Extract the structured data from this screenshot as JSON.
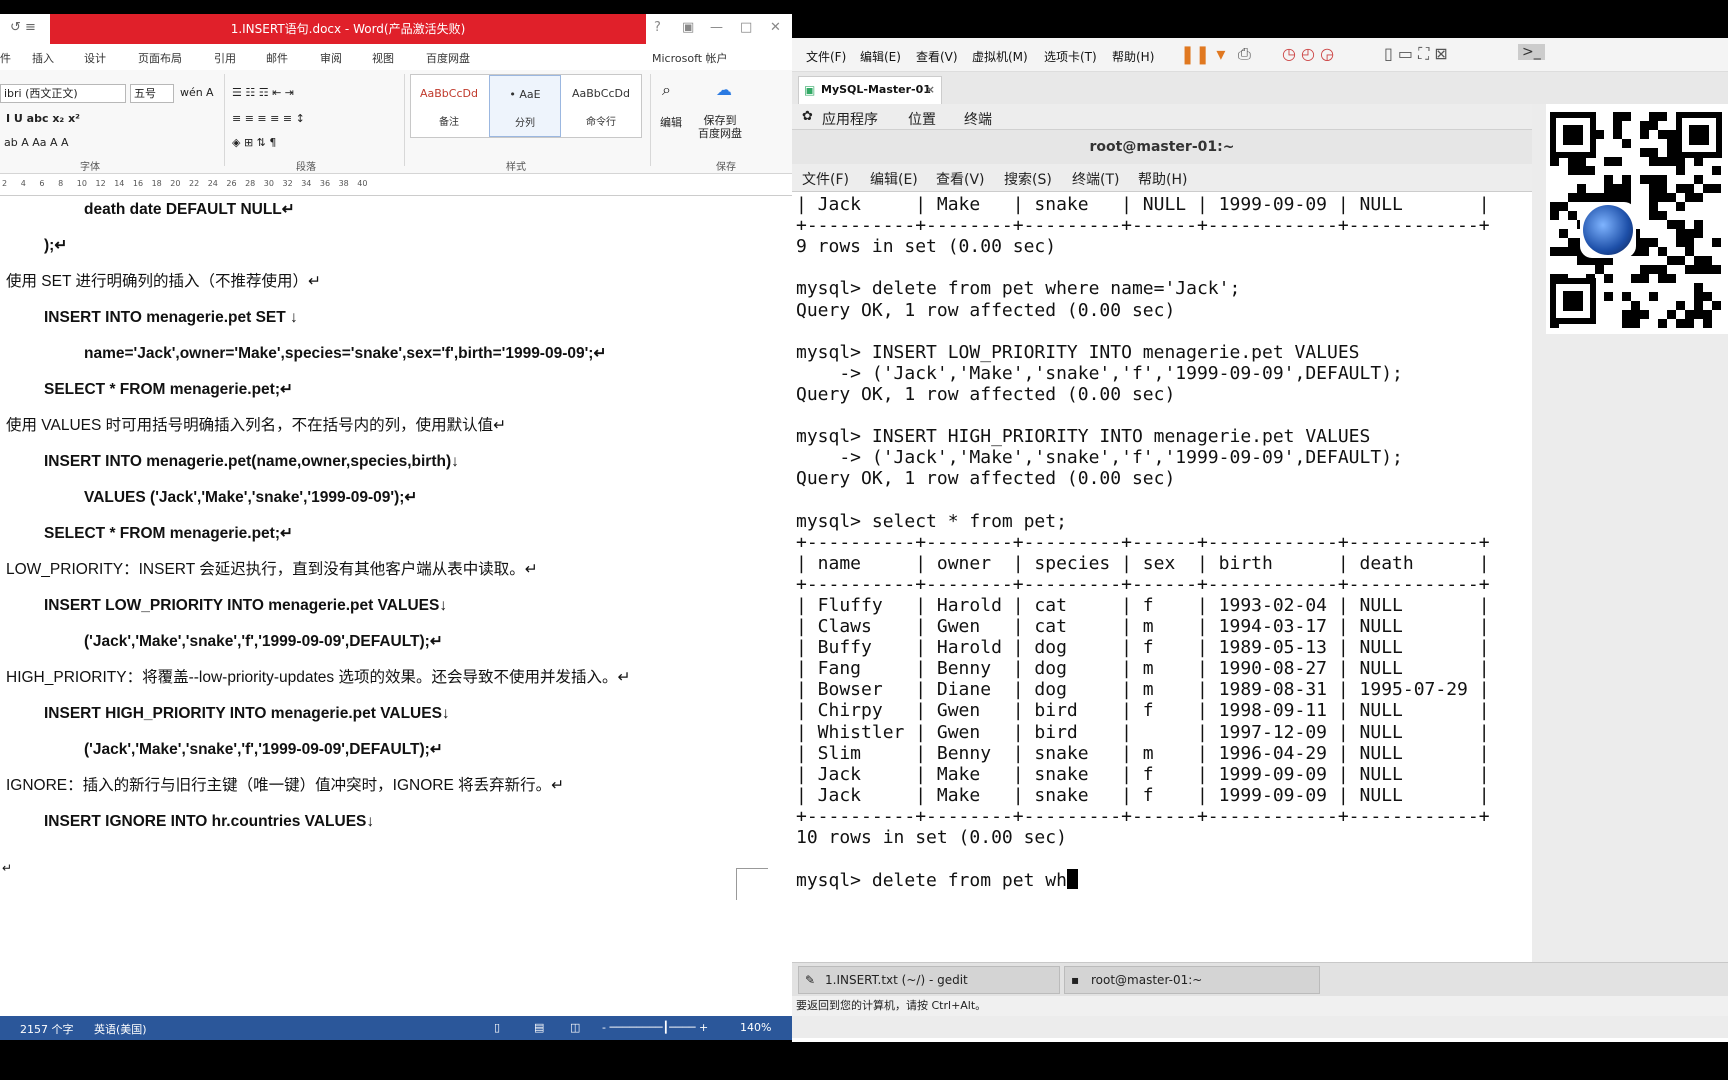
{
  "word": {
    "quick_access": "↺ ≡",
    "title": "1.INSERT语句.docx - Word(产品激活失败)",
    "window_controls": [
      "?",
      "▣",
      "—",
      "□",
      "✕"
    ],
    "tabs": [
      "件",
      "插入",
      "设计",
      "页面布局",
      "引用",
      "邮件",
      "审阅",
      "视图",
      "百度网盘"
    ],
    "account": "Microsoft 帐户",
    "ribbon": {
      "font_name": "ibri (西文正文)",
      "font_size": "五号",
      "groups": [
        "字体",
        "段落",
        "样式",
        "保存"
      ],
      "styles": [
        {
          "preview": "AaBbCcDd",
          "name": "备注"
        },
        {
          "preview": "• AaE",
          "name": "分列"
        },
        {
          "preview": "AaBbCcDd",
          "name": "命令行"
        }
      ],
      "edit_label": "编辑",
      "save_label": "保存到\n百度网盘"
    },
    "ruler_ticks": [
      "2",
      "4",
      "6",
      "8",
      "10",
      "12",
      "14",
      "16",
      "18",
      "20",
      "22",
      "24",
      "26",
      "28",
      "30",
      "32",
      "34",
      "36",
      "38",
      "40"
    ],
    "doc_lines": [
      "death date DEFAULT NULL↵",
      ");↵",
      "使用 SET 进行明确列的插入（不推荐使用）↵",
      "INSERT INTO menagerie.pet SET  ↓",
      "name='Jack',owner='Make',species='snake',sex='f',birth='1999-09-09';↵",
      "SELECT * FROM menagerie.pet;↵",
      "使用 VALUES 时可用括号明确插入列名，不在括号内的列，使用默认值↵",
      "INSERT INTO menagerie.pet(name,owner,species,birth)↓",
      "VALUES ('Jack','Make','snake','1999-09-09');↵",
      "SELECT * FROM menagerie.pet;↵",
      "LOW_PRIORITY：INSERT 会延迟执行，直到没有其他客户端从表中读取。↵",
      "INSERT LOW_PRIORITY INTO menagerie.pet VALUES↓",
      "('Jack','Make','snake','f','1999-09-09',DEFAULT);↵",
      "HIGH_PRIORITY：将覆盖--low-priority-updates  选项的效果。还会导致不使用并发插入。↵",
      "INSERT HIGH_PRIORITY INTO menagerie.pet VALUES↓",
      "('Jack','Make','snake','f','1999-09-09',DEFAULT);↵",
      "IGNORE：插入的新行与旧行主键（唯一键）值冲突时，IGNORE 将丢弃新行。↵",
      "INSERT IGNORE INTO hr.countries VALUES↓",
      "↵"
    ],
    "status": {
      "word_count": "2157 个字",
      "language": "英语(美国)",
      "zoom": "140%"
    }
  },
  "vm": {
    "menu": [
      "文件(F)",
      "编辑(E)",
      "查看(V)",
      "虚拟机(M)",
      "选项卡(T)",
      "帮助(H)"
    ],
    "tab": "MySQL-Master-01",
    "guest_top": [
      "应用程序",
      "位置",
      "终端"
    ],
    "terminal_title": "root@master-01:~",
    "terminal_menu": [
      "文件(F)",
      "编辑(E)",
      "查看(V)",
      "搜索(S)",
      "终端(T)",
      "帮助(H)"
    ],
    "terminal_lines": [
      "| Jack     | Make   | snake   | NULL | 1999-09-09 | NULL       |",
      "+----------+--------+---------+------+------------+------------+",
      "9 rows in set (0.00 sec)",
      "",
      "mysql> delete from pet where name='Jack';",
      "Query OK, 1 row affected (0.00 sec)",
      "",
      "mysql> INSERT LOW_PRIORITY INTO menagerie.pet VALUES",
      "    -> ('Jack','Make','snake','f','1999-09-09',DEFAULT);",
      "Query OK, 1 row affected (0.00 sec)",
      "",
      "mysql> INSERT HIGH_PRIORITY INTO menagerie.pet VALUES",
      "    -> ('Jack','Make','snake','f','1999-09-09',DEFAULT);",
      "Query OK, 1 row affected (0.00 sec)",
      "",
      "mysql> select * from pet;",
      "+----------+--------+---------+------+------------+------------+",
      "| name     | owner  | species | sex  | birth      | death      |",
      "+----------+--------+---------+------+------------+------------+",
      "| Fluffy   | Harold | cat     | f    | 1993-02-04 | NULL       |",
      "| Claws    | Gwen   | cat     | m    | 1994-03-17 | NULL       |",
      "| Buffy    | Harold | dog     | f    | 1989-05-13 | NULL       |",
      "| Fang     | Benny  | dog     | m    | 1990-08-27 | NULL       |",
      "| Bowser   | Diane  | dog     | m    | 1989-08-31 | 1995-07-29 |",
      "| Chirpy   | Gwen   | bird    | f    | 1998-09-11 | NULL       |",
      "| Whistler | Gwen   | bird    |      | 1997-12-09 | NULL       |",
      "| Slim     | Benny  | snake   | m    | 1996-04-29 | NULL       |",
      "| Jack     | Make   | snake   | f    | 1999-09-09 | NULL       |",
      "| Jack     | Make   | snake   | f    | 1999-09-09 | NULL       |",
      "+----------+--------+---------+------+------------+------------+",
      "10 rows in set (0.00 sec)",
      "",
      "mysql> delete from pet wh"
    ],
    "taskbar": [
      "1.INSERT.txt (~/) - gedit",
      "root@master-01:~"
    ],
    "status": "要返回到您的计算机，请按 Ctrl+Alt。"
  }
}
